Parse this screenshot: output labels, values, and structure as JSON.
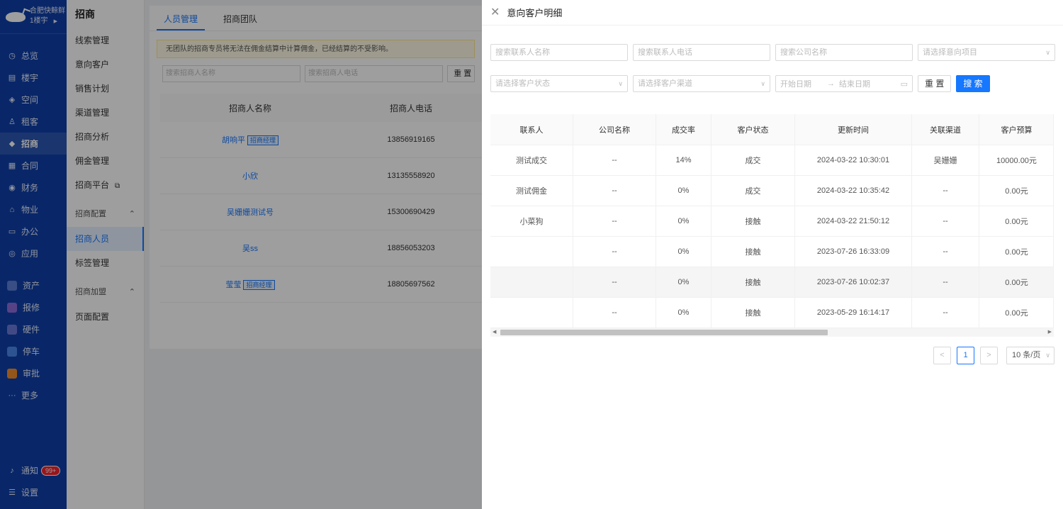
{
  "nav": {
    "brand_name": "合肥快鲸鲜",
    "building": "1楼宇",
    "items": [
      {
        "label": "总览",
        "icon": "dashboard-icon",
        "glyph": "◷"
      },
      {
        "label": "楼宇",
        "icon": "building-icon",
        "glyph": "▤"
      },
      {
        "label": "空间",
        "icon": "space-icon",
        "glyph": "◈"
      },
      {
        "label": "租客",
        "icon": "tenant-icon",
        "glyph": "♙"
      },
      {
        "label": "招商",
        "icon": "tag-icon",
        "glyph": "◆"
      },
      {
        "label": "合同",
        "icon": "contract-icon",
        "glyph": "▦"
      },
      {
        "label": "财务",
        "icon": "finance-icon",
        "glyph": "◉"
      },
      {
        "label": "物业",
        "icon": "property-icon",
        "glyph": "⌂"
      },
      {
        "label": "办公",
        "icon": "office-icon",
        "glyph": "▭"
      },
      {
        "label": "应用",
        "icon": "apps-icon",
        "glyph": "◎"
      }
    ],
    "apps": [
      {
        "label": "资产",
        "icon": "asset-icon",
        "color": "#5b7fd6"
      },
      {
        "label": "报修",
        "icon": "repair-icon",
        "color": "#8e6bd8"
      },
      {
        "label": "硬件",
        "icon": "hardware-icon",
        "color": "#6b78d8"
      },
      {
        "label": "停车",
        "icon": "parking-icon",
        "color": "#4a86e8"
      },
      {
        "label": "审批",
        "icon": "approval-icon",
        "color": "#f08c2b"
      }
    ],
    "more": "更多",
    "notify": "通知",
    "notify_badge": "99+",
    "settings": "设置"
  },
  "submenu": {
    "title": "招商",
    "items": [
      "线索管理",
      "意向客户",
      "销售计划",
      "渠道管理",
      "招商分析",
      "佣金管理",
      "招商平台"
    ],
    "group1": "招商配置",
    "group1_items": [
      "招商人员",
      "标签管理"
    ],
    "group2": "招商加盟",
    "group2_items": [
      "页面配置"
    ]
  },
  "bg": {
    "tabs": [
      "人员管理",
      "招商团队"
    ],
    "notice": "无团队的招商专员将无法在佣金结算中计算佣金，已经结算的不受影响。",
    "search_name_ph": "搜索招商人名称",
    "search_phone_ph": "搜索招商人电话",
    "reset": "重 置",
    "col_name": "招商人名称",
    "col_phone": "招商人电话",
    "rows": [
      {
        "name": "胡响平",
        "tag": "招商经理",
        "phone": "13856919165"
      },
      {
        "name": "小欣",
        "tag": "",
        "phone": "13135558920"
      },
      {
        "name": "吴姗姗测试号",
        "tag": "",
        "phone": "15300690429"
      },
      {
        "name": "吴ss",
        "tag": "",
        "phone": "18856053203"
      },
      {
        "name": "莹莹",
        "tag": "招商经理",
        "phone": "18805697562"
      }
    ]
  },
  "drawer": {
    "title": "意向客户明细",
    "filters": {
      "contact_name_ph": "搜索联系人名称",
      "contact_phone_ph": "搜索联系人电话",
      "company_ph": "搜索公司名称",
      "project_ph": "请选择意向项目",
      "status_ph": "请选择客户状态",
      "channel_ph": "请选择客户渠道",
      "start_date_ph": "开始日期",
      "end_date_ph": "结束日期",
      "reset": "重 置",
      "search": "搜 索"
    },
    "columns": [
      "联系人",
      "公司名称",
      "成交率",
      "客户状态",
      "更新时间",
      "关联渠道",
      "客户预算"
    ],
    "rows": [
      [
        "测试成交",
        "--",
        "14%",
        "成交",
        "2024-03-22 10:30:01",
        "吴姗姗",
        "10000.00元"
      ],
      [
        "测试佣金",
        "--",
        "0%",
        "成交",
        "2024-03-22 10:35:42",
        "--",
        "0.00元"
      ],
      [
        "小菜狗",
        "--",
        "0%",
        "接触",
        "2024-03-22 21:50:12",
        "--",
        "0.00元"
      ],
      [
        "",
        "--",
        "0%",
        "接触",
        "2023-07-26 16:33:09",
        "--",
        "0.00元"
      ],
      [
        "",
        "--",
        "0%",
        "接触",
        "2023-07-26 10:02:37",
        "--",
        "0.00元"
      ],
      [
        "",
        "--",
        "0%",
        "接触",
        "2023-05-29 16:14:17",
        "--",
        "0.00元"
      ]
    ],
    "pager": {
      "prev": "<",
      "current": "1",
      "next": ">",
      "page_size": "10 条/页"
    }
  }
}
